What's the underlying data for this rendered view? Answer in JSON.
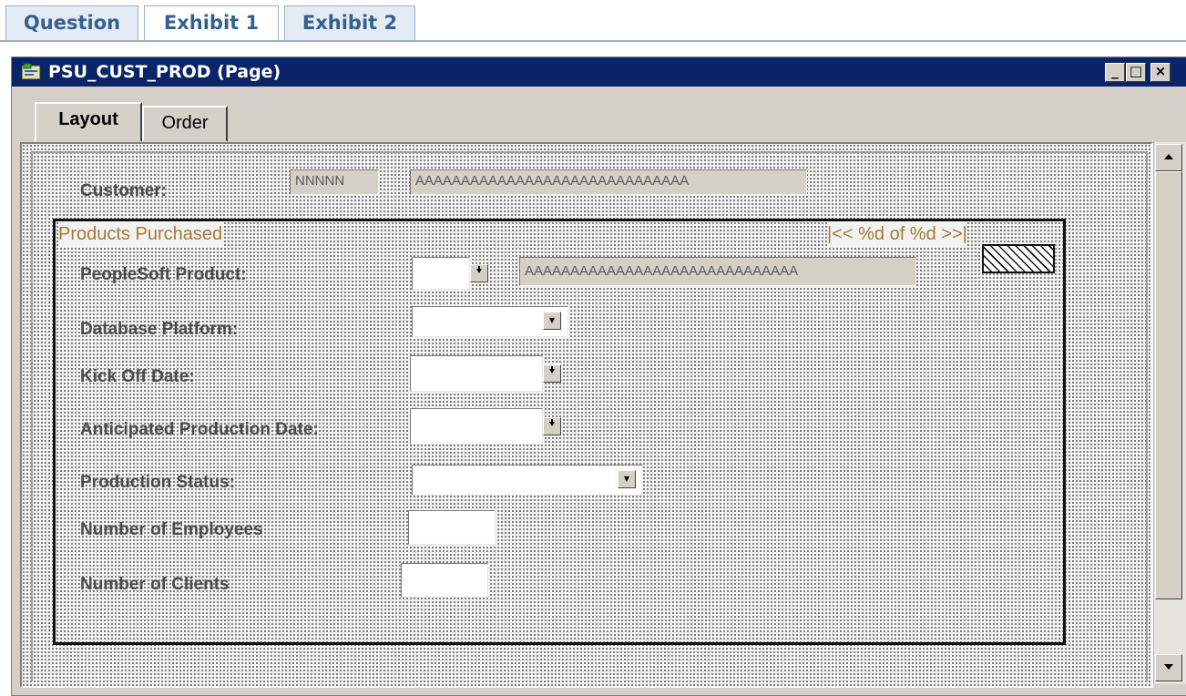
{
  "exhibit_tabs": [
    {
      "label": "Question",
      "active": false
    },
    {
      "label": "Exhibit 1",
      "active": true
    },
    {
      "label": "Exhibit 2",
      "active": false
    }
  ],
  "window": {
    "title": "PSU_CUST_PROD (Page)",
    "controls": {
      "minimize": "_",
      "maximize": "□",
      "close": "×"
    }
  },
  "inner_tabs": [
    {
      "label": "Layout",
      "active": true
    },
    {
      "label": "Order",
      "active": false
    }
  ],
  "customer": {
    "label": "Customer:",
    "id_value": "NNNNN",
    "name_value": "AAAAAAAAAAAAAAAAAAAAAAAAAAAAAA"
  },
  "grid": {
    "title": "Products Purchased",
    "navigator": "|<< %d of %d >>|",
    "fields": [
      {
        "label": "PeopleSoft Product:",
        "placeholder_value": "AAAAAAAAAAAAAAAAAAAAAAAAAAAAAA"
      },
      {
        "label": "Database Platform:"
      },
      {
        "label": "Kick Off Date:"
      },
      {
        "label": "Anticipated Production Date:"
      },
      {
        "label": "Production Status:"
      },
      {
        "label": "Number of Employees"
      },
      {
        "label": "Number of Clients"
      }
    ]
  },
  "icons": {
    "dropdown_prompt": "down-arrow",
    "scroll_up": "up-arrow",
    "scroll_down": "down-arrow"
  }
}
